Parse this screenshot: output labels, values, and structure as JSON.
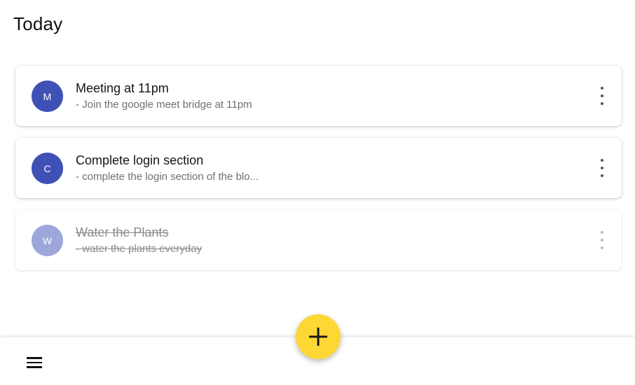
{
  "header": {
    "title": "Today"
  },
  "tasks": [
    {
      "avatar_letter": "M",
      "title": "Meeting at 11pm",
      "subtitle": "- Join the google meet bridge at 11pm",
      "completed": false
    },
    {
      "avatar_letter": "C",
      "title": "Complete login section",
      "subtitle": "- complete the login section of the blo...",
      "completed": false
    },
    {
      "avatar_letter": "W",
      "title": "Water the Plants",
      "subtitle": "- water the plants everyday",
      "completed": true
    }
  ],
  "icons": {
    "row_menu": "more-vert-icon",
    "fab": "plus-icon",
    "bottom_menu": "menu-icon"
  },
  "colors": {
    "avatar": "#3f51b5",
    "fab": "#fdd835",
    "fab_icon": "#1a1a1a"
  }
}
